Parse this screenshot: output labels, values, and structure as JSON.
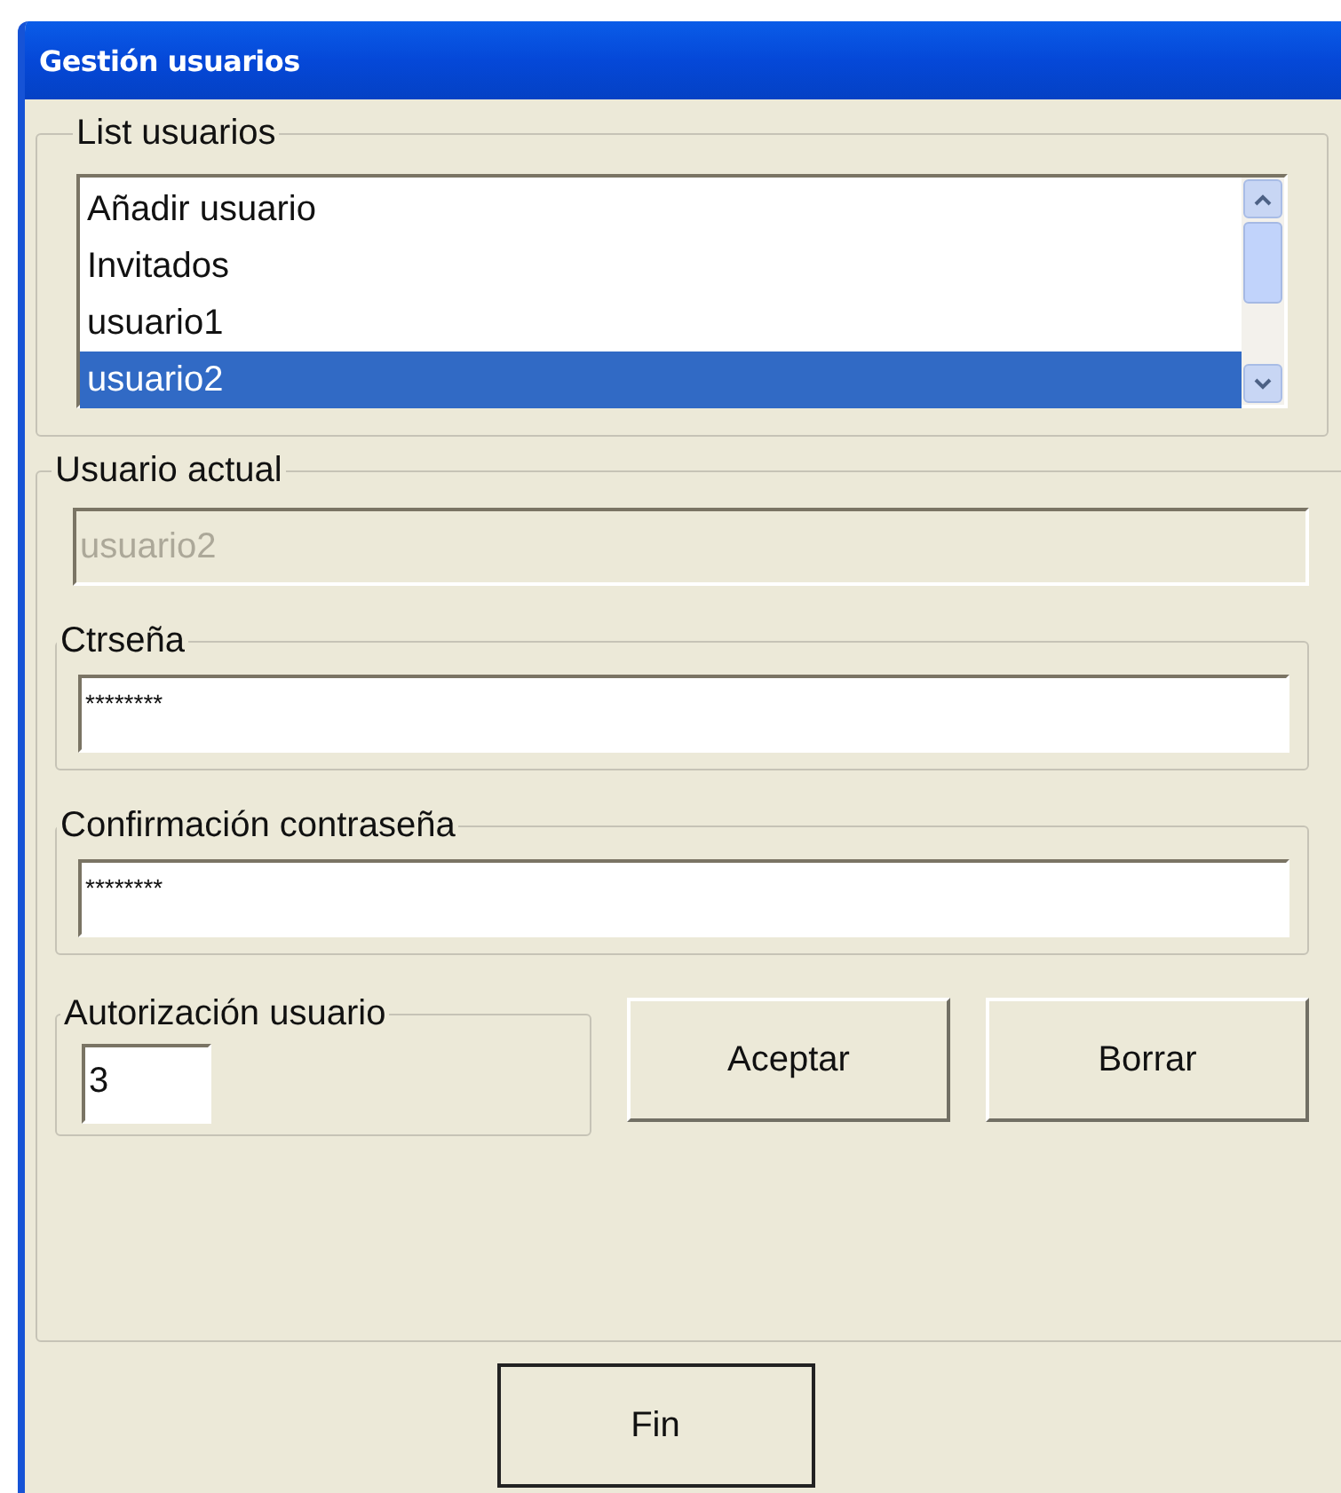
{
  "window": {
    "title": "Gestión usuarios"
  },
  "user_list": {
    "label": "List usuarios",
    "items": [
      {
        "label": "Añadir usuario",
        "selected": false
      },
      {
        "label": "Invitados",
        "selected": false
      },
      {
        "label": "usuario1",
        "selected": false
      },
      {
        "label": "usuario2",
        "selected": true
      }
    ]
  },
  "current_user": {
    "label": "Usuario actual",
    "field": {
      "value": "usuario2",
      "disabled": true
    },
    "password": {
      "label": "Ctrseña",
      "value": "********"
    },
    "confirm": {
      "label": "Confirmación contraseña",
      "value": "********"
    },
    "authorization": {
      "label": "Autorización usuario",
      "value": "3"
    },
    "buttons": [
      "Aceptar",
      "Borrar"
    ]
  },
  "footer_button": "Fin"
}
